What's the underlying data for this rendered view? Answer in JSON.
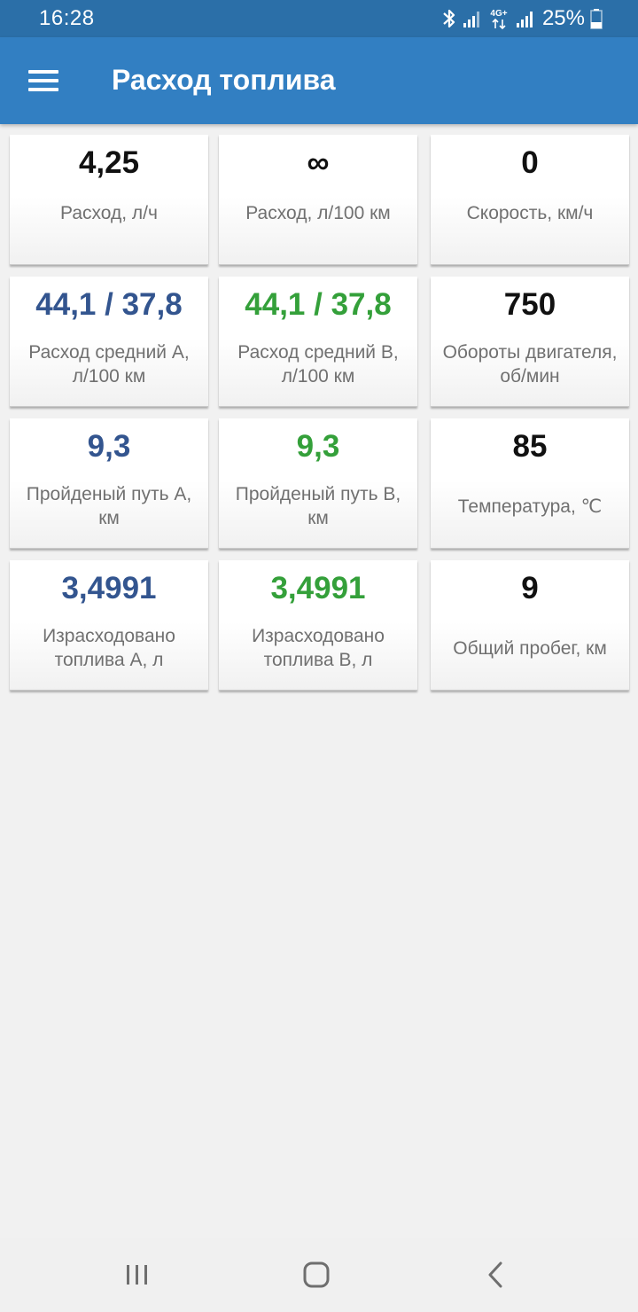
{
  "status": {
    "time": "16:28",
    "battery": "25%",
    "network": "4G+",
    "icons": [
      "bluetooth-icon",
      "signal-icon",
      "signal-icon",
      "battery-icon"
    ]
  },
  "app_bar": {
    "title": "Расход топлива",
    "menu_icon": "menu-icon"
  },
  "colors": {
    "status_bar": "#2b6fa8",
    "app_bar": "#327fc2",
    "value_default": "#111111",
    "value_a": "#33558f",
    "value_b": "#34a03a",
    "label": "#707070",
    "background": "#f1f1f1"
  },
  "tiles": [
    {
      "value": "4,25",
      "label": "Расход, л/ч"
    },
    {
      "value": "∞",
      "label": "Расход, л/100 км"
    },
    {
      "value": "0",
      "label": "Скорость, км/ч"
    },
    {
      "value": "44,1 / 37,8",
      "label": "Расход средний A, л/100 км"
    },
    {
      "value": "44,1 / 37,8",
      "label": "Расход средний B, л/100 км"
    },
    {
      "value": "750",
      "label": "Обороты двигателя, об/мин"
    },
    {
      "value": "9,3",
      "label": "Пройденый путь A, км"
    },
    {
      "value": "9,3",
      "label": "Пройденый путь B, км"
    },
    {
      "value": "85",
      "label": "Температура, ℃"
    },
    {
      "value": "3,4991",
      "label": "Израсходовано топлива A, л"
    },
    {
      "value": "3,4991",
      "label": "Израсходовано топлива B, л"
    },
    {
      "value": "9",
      "label": "Общий пробег, км"
    }
  ],
  "nav": {
    "icons": [
      "recent-apps-icon",
      "home-icon",
      "back-icon"
    ]
  }
}
